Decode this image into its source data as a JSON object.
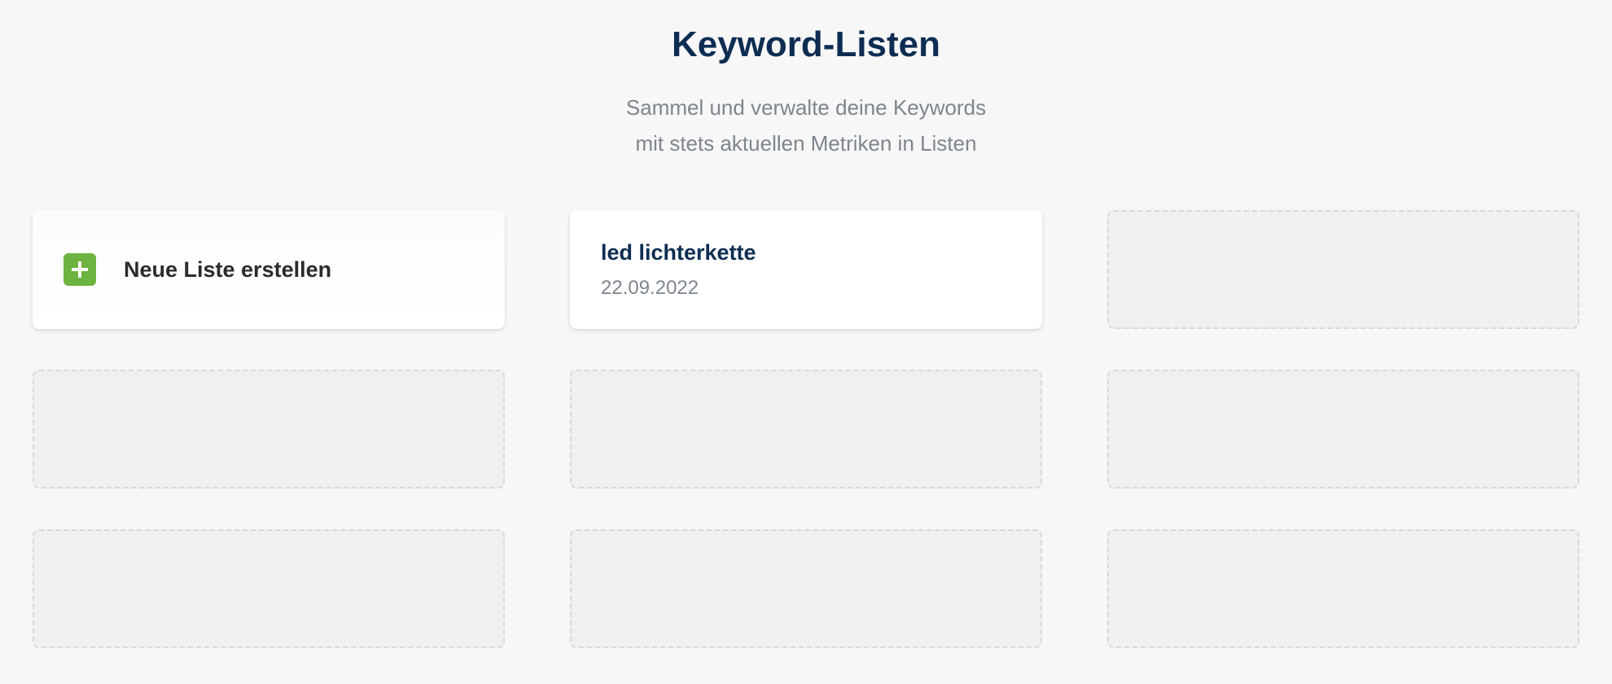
{
  "header": {
    "title": "Keyword-Listen",
    "subtitle_line1": "Sammel und verwalte deine Keywords",
    "subtitle_line2": "mit stets aktuellen Metriken in Listen"
  },
  "new_list": {
    "label": "Neue Liste erstellen"
  },
  "lists": [
    {
      "title": "led lichterkette",
      "date": "22.09.2022"
    }
  ]
}
